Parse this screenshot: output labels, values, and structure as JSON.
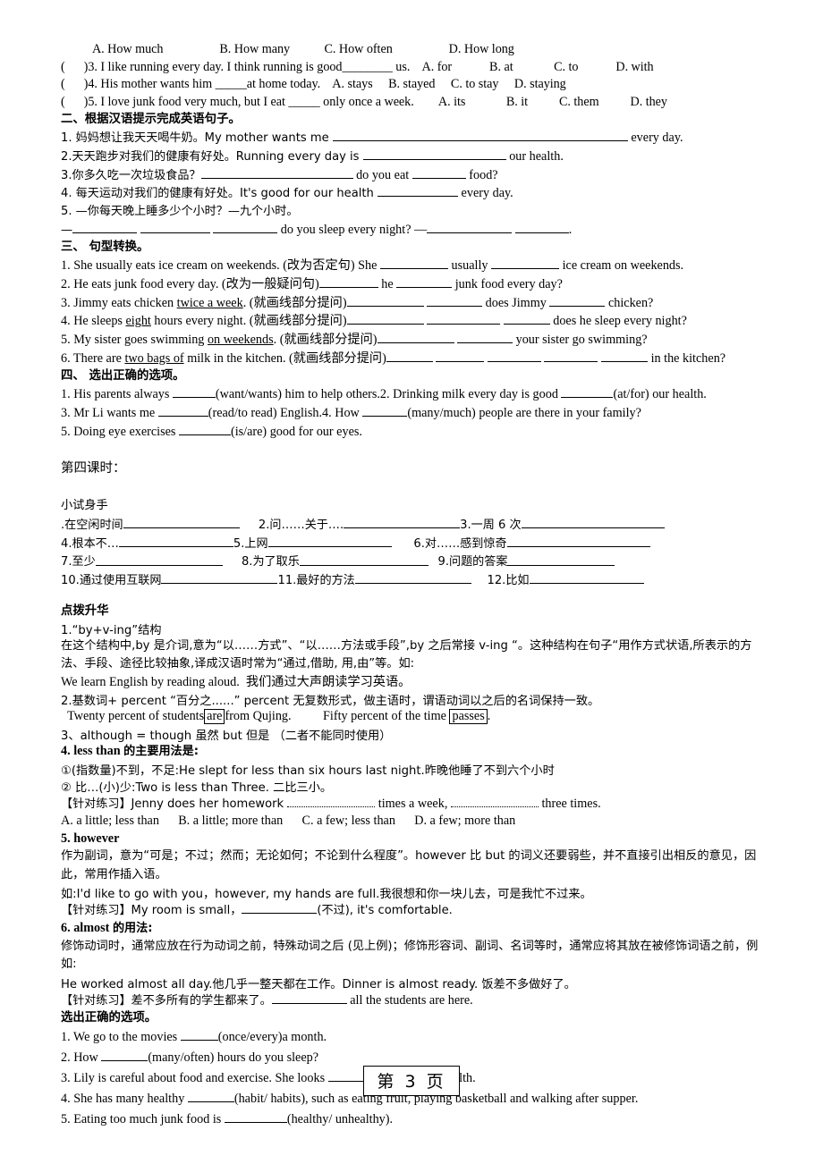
{
  "document": {
    "page_footer": "第 3 页"
  },
  "section_choice_cont": {
    "q2_options": "          A. How much                  B. How many           C. How often                  D. How long",
    "q3": "(      )3. I like running every day. I think running is good________ us.    A. for            B. at             C. to            D. with",
    "q4": "(      )4. His mother wants him _____at home today.    A. stays     B. stayed     C. to stay     D. staying",
    "q5": "(      )5. I love junk food very much, but I eat _____ only once a week.        A. its             B. it          C. them          D. they"
  },
  "section_two": {
    "heading": "二、根据汉语提示完成英语句子。",
    "q1_a": "1. 妈妈想让我天天喝牛奶。My mother wants me ",
    "q1_b": " every day.",
    "q2_a": "2.天天跑步对我们的健康有好处。Running every day is ",
    "q2_b": " our health.",
    "q3_a": "3.你多久吃一次垃圾食品？",
    "q3_b": " do you eat ",
    "q3_c": " food?",
    "q4_a": "4. 每天运动对我们的健康有好处。It's good for our health ",
    "q4_b": " every day.",
    "q5_line1": "5. —你每天晚上睡多少个小时？—九个小时。",
    "q5_line2_a": "—",
    "q5_line2_b": " do you sleep every night? —",
    "q5_line2_c": "."
  },
  "section_three": {
    "heading": "三、 句型转换。",
    "q1_a": "1. She usually eats ice cream on weekends. (改为否定句) She ",
    "q1_b": " usually ",
    "q1_c": " ice cream on weekends.",
    "q2_a": "2. He eats junk food every day. (改为一般疑问句)",
    "q2_b": " he ",
    "q2_c": " junk food every day?",
    "q3_a": "3. Jimmy eats chicken ",
    "q3_underlined": "twice a week",
    "q3_b": ". (就画线部分提问)",
    "q3_c": " does Jimmy ",
    "q3_d": " chicken?",
    "q4_a": "4. He sleeps ",
    "q4_underlined": "eight",
    "q4_b": " hours every night. (就画线部分提问)",
    "q4_c": " does he sleep every night?",
    "q5_a": "5. My sister goes swimming ",
    "q5_underlined": "on weekends",
    "q5_b": ". (就画线部分提问)",
    "q5_c": " your sister go swimming?",
    "q6_a": "6. There are ",
    "q6_underlined": "two bags of",
    "q6_b": " milk in the kitchen. (就画线部分提问)",
    "q6_c": " in the kitchen?"
  },
  "section_four": {
    "heading": "四、 选出正确的选项。",
    "q1_a": "1. His parents always ",
    "q1_b": "(want/wants) him to help others.2. Drinking milk every day is good ",
    "q1_c": "(at/for) our health.",
    "q3_a": "3. Mr Li wants me ",
    "q3_b": "(read/to read) English.4. How ",
    "q3_c": "(many/much) people are there in your family?",
    "q5_a": "5. Doing eye exercises ",
    "q5_b": "(is/are) good for our eyes."
  },
  "lesson_four": {
    "title": "第四课时："
  },
  "warmup": {
    "heading": "小试身手",
    "items": [
      {
        "label": ".在空闲时间"
      },
      {
        "label": "2.问……关于…."
      },
      {
        "label": "3.一周 6 次"
      },
      {
        "label": "4.根本不…"
      },
      {
        "label": "5.上网"
      },
      {
        "label": "6.对……感到惊奇"
      },
      {
        "label": "7.至少"
      },
      {
        "label": "8.为了取乐"
      },
      {
        "label": "9.问题的答案"
      },
      {
        "label": "10.通过使用互联网"
      },
      {
        "label": "11.最好的方法"
      },
      {
        "label": "12.比如"
      }
    ]
  },
  "tips": {
    "heading": "点拨升华",
    "item1_title": "1.“by+v-ing”结构",
    "item1_body": "在这个结构中,by 是介词,意为“以……方式”、“以……方法或手段”,by 之后常接 v-ing “。这种结构在句子“用作方式状语,所表示的方法、手段、途径比较抽象,译成汉语时常为“通过,借助, 用,由”等。如:",
    "item1_example": "We learn English by reading aloud.  我们通过大声朗读学习英语。",
    "item2_title": "2.基数词+ percent    “百分之......” percent  无复数形式，做主语时，谓语动词以之后的名词保持一致。",
    "item2_ex_a": "  Twenty percent of students",
    "item2_ex_boxed1": "are",
    "item2_ex_b": "from Qujing.          Fifty percent of the time ",
    "item2_ex_boxed2": "passes",
    "item2_ex_c": ".",
    "item3": "3、although = though  虽然       but  但是   （二者不能同时使用）",
    "item4_title_bold": "4. less than ",
    "item4_title_cn": "的主要用法是:",
    "item4_p1": "①(指数量)不到，不足:He slept for less than six hours last night.昨晚他睡了不到六个小时",
    "item4_p2": "② 比…(小)少:Two is less than Three. 二比三小。",
    "item4_prac_a": "【针对练习】Jenny does her homework ",
    "item4_prac_b": " times a week, ",
    "item4_prac_c": " three times.",
    "item4_options": "A. a little; less than      B. a little; more than      C. a few; less than      D. a few; more than",
    "item5_title": "5. however",
    "item5_body": "作为副词，意为“可是；不过；然而；无论如何；不论到什么程度”。however 比 but 的词义还要弱些，并不直接引出相反的意见，因此，常用作插入语。",
    "item5_example": "如:I'd like to go with you，however, my hands are full.我很想和你一块儿去，可是我忙不过来。",
    "item5_prac_a": "【针对练习】My room is small，",
    "item5_prac_b": "(不过), it's comfortable.",
    "item6_title_bold": "6. almost ",
    "item6_title_cn": "的用法:",
    "item6_body": "    修饰动词时，通常应放在行为动词之前，特殊动词之后 (见上例)；修饰形容词、副词、名词等时，通常应将其放在被修饰词语之前，例如:",
    "item6_example": "He worked almost all day.他几乎一整天都在工作。Dinner is almost ready.  饭差不多做好了。",
    "item6_prac_a": "【针对练习】差不多所有的学生都来了。",
    "item6_prac_b": " all the students are here."
  },
  "final_choice": {
    "heading": "选出正确的选项。",
    "q1_a": "1. We go to the movies ",
    "q1_b": "(once/every)a month.",
    "q2_a": "2. How ",
    "q2_b": "(many/often) hours do you sleep?",
    "q3_a": "3. Lily is careful about food and exercise. She looks ",
    "q3_b": "(at/after) her health.",
    "q4_a": "4. She has many healthy ",
    "q4_b": "(habit/ habits), such as eating fruit, playing basketball and walking after supper.",
    "q5_a": "5. Eating too much junk food is ",
    "q5_b": "(healthy/ unhealthy)."
  }
}
